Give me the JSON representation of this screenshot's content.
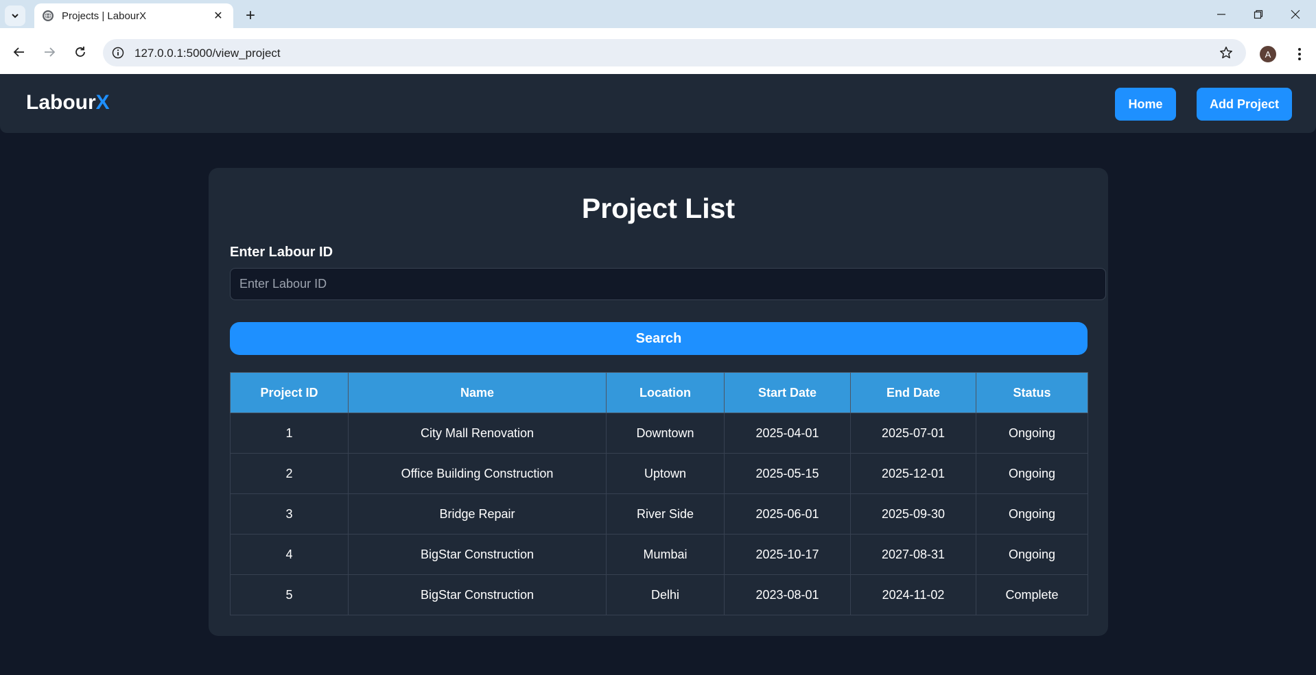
{
  "browser": {
    "tab_title": "Projects | LabourX",
    "url": "127.0.0.1:5000/view_project",
    "profile_initial": "A"
  },
  "header": {
    "brand_main": "Labour",
    "brand_accent": "X",
    "home_label": "Home",
    "add_project_label": "Add Project"
  },
  "main": {
    "title": "Project List",
    "labour_id_label": "Enter Labour ID",
    "labour_id_placeholder": "Enter Labour ID",
    "labour_id_value": "",
    "search_label": "Search"
  },
  "table": {
    "columns": [
      "Project ID",
      "Name",
      "Location",
      "Start Date",
      "End Date",
      "Status"
    ],
    "rows": [
      [
        "1",
        "City Mall Renovation",
        "Downtown",
        "2025-04-01",
        "2025-07-01",
        "Ongoing"
      ],
      [
        "2",
        "Office Building Construction",
        "Uptown",
        "2025-05-15",
        "2025-12-01",
        "Ongoing"
      ],
      [
        "3",
        "Bridge Repair",
        "River Side",
        "2025-06-01",
        "2025-09-30",
        "Ongoing"
      ],
      [
        "4",
        "BigStar Construction",
        "Mumbai",
        "2025-10-17",
        "2027-08-31",
        "Ongoing"
      ],
      [
        "5",
        "BigStar Construction",
        "Delhi",
        "2023-08-01",
        "2024-11-02",
        "Complete"
      ]
    ]
  },
  "colors": {
    "page_bg": "#111827",
    "panel_bg": "#1f2937",
    "accent": "#1e90ff",
    "table_header": "#3498db"
  }
}
